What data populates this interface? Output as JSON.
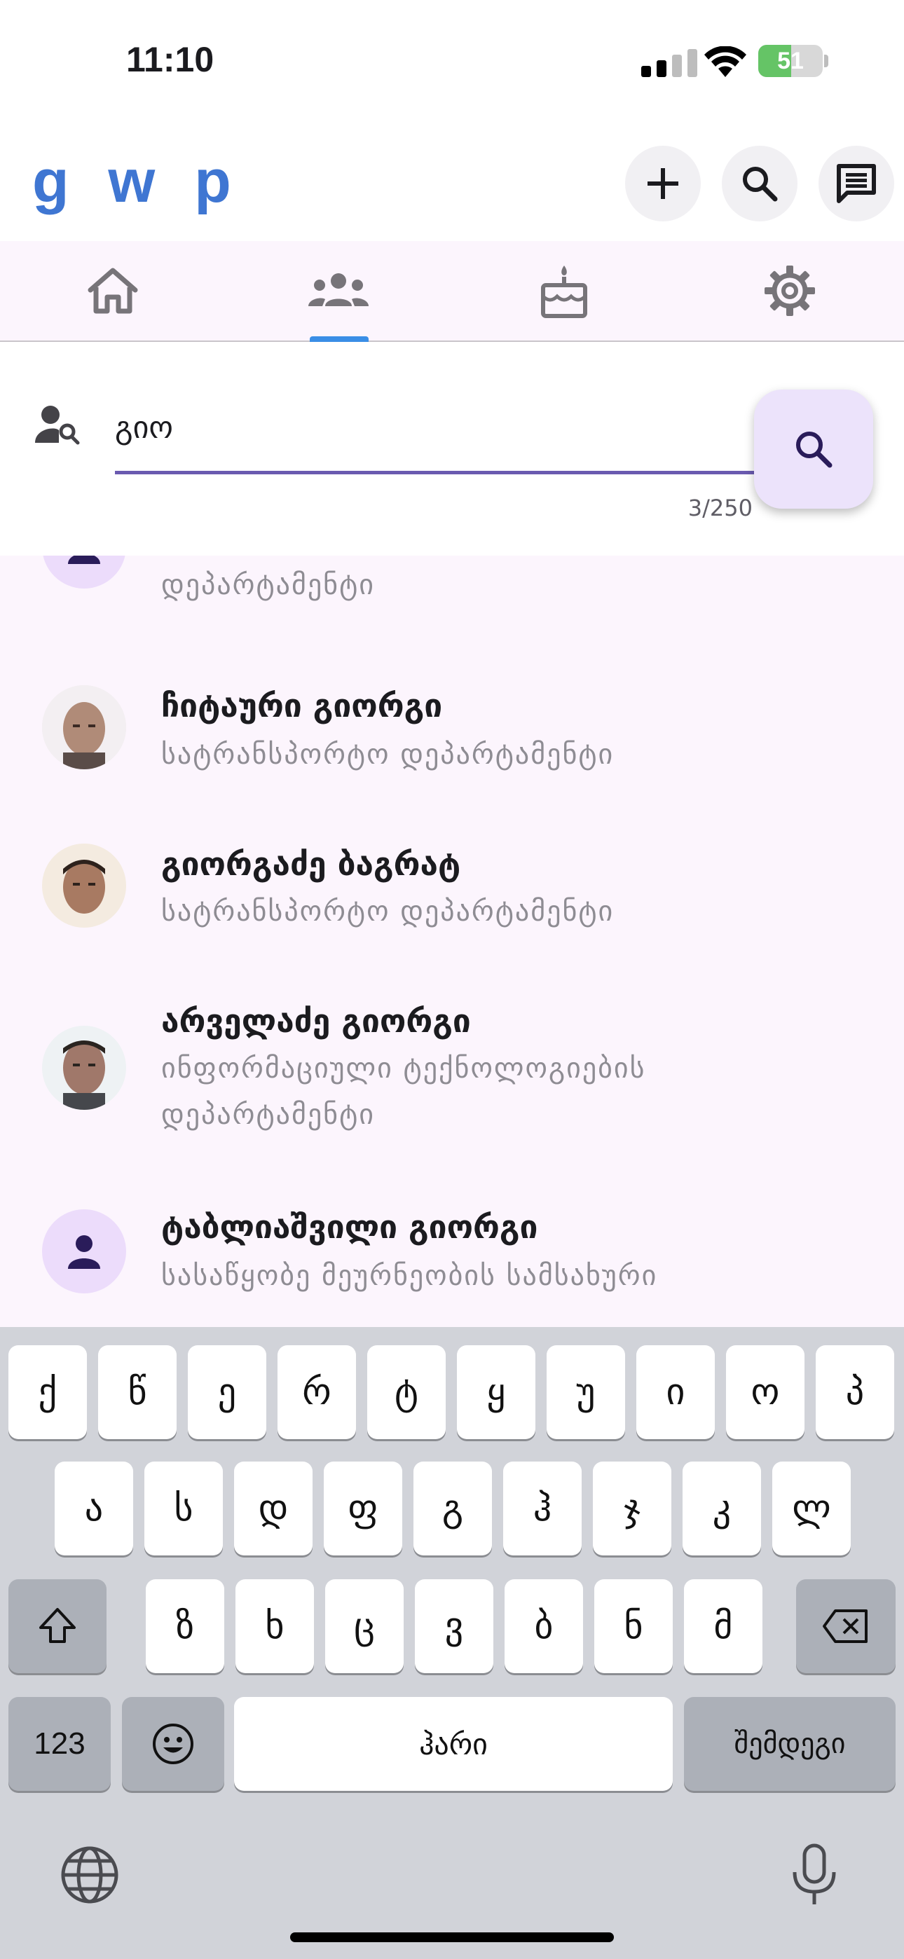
{
  "status_bar": {
    "time": "11:10",
    "battery": "51",
    "battery_level": 0.51
  },
  "app_bar": {
    "logo": "g w p"
  },
  "tabs": [
    {
      "name": "home",
      "icon": "home-icon"
    },
    {
      "name": "people",
      "icon": "groups-icon",
      "active": true
    },
    {
      "name": "birthdays",
      "icon": "cake-icon"
    },
    {
      "name": "settings",
      "icon": "gear-icon"
    }
  ],
  "search": {
    "value": "გიო",
    "counter": "3/250"
  },
  "list": {
    "partial_item": {
      "subtitle": "დეპარტამენტი"
    },
    "items": [
      {
        "name": "ჩიტაური გიორგი",
        "subtitle": "სატრანსპორტო დეპარტამენტი"
      },
      {
        "name": "გიორგაძე ბაგრატ",
        "subtitle": "სატრანსპორტო დეპარტამენტი"
      },
      {
        "name": "არველაძე გიორგი",
        "subtitle_line1": "ინფორმაციული ტექნოლოგიების",
        "subtitle_line2": "დეპარტამენტი"
      },
      {
        "name": "ტაბლიაშვილი გიორგი",
        "subtitle": "სასაწყობე მეურნეობის სამსახური"
      }
    ]
  },
  "keyboard": {
    "row1": [
      "ქ",
      "წ",
      "ე",
      "რ",
      "ტ",
      "ყ",
      "უ",
      "ი",
      "ო",
      "პ"
    ],
    "row2": [
      "ა",
      "ს",
      "დ",
      "ფ",
      "გ",
      "ჰ",
      "ჯ",
      "კ",
      "ლ"
    ],
    "row3": [
      "ზ",
      "ხ",
      "ც",
      "ვ",
      "ბ",
      "ნ",
      "მ"
    ],
    "numbers_key": "123",
    "space_key": "ჰარი",
    "next_key": "შემდეგი"
  },
  "colors": {
    "accent": "#3f76d2",
    "fab": "#ece3fb",
    "list_bg": "#fcf5fd",
    "keyboard_bg": "#d1d3d9"
  }
}
